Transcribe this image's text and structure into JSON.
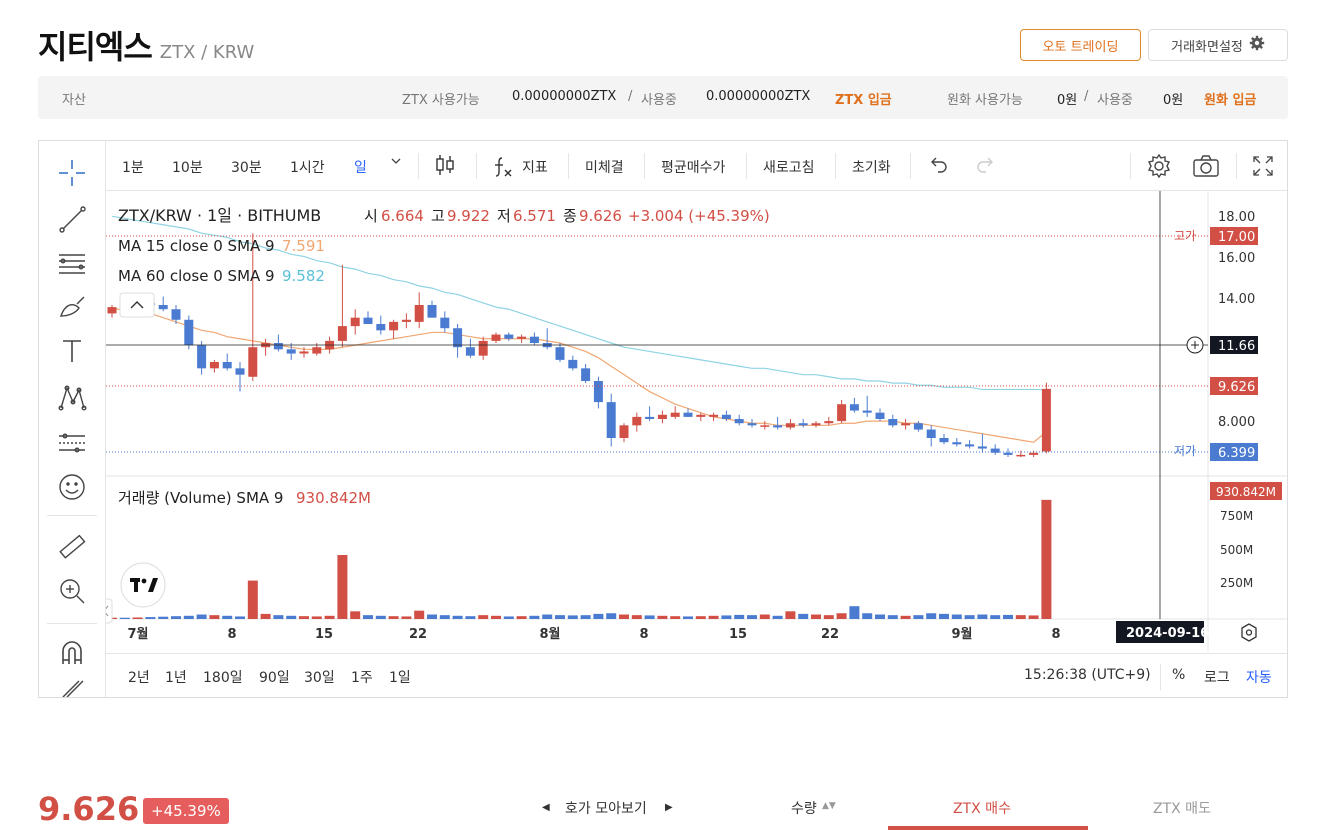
{
  "header": {
    "coin_name": "지티엑스",
    "pair": "ZTX / KRW",
    "auto_trading": "오토 트레이딩",
    "screen_settings": "거래화면설정"
  },
  "asset": {
    "label": "자산",
    "ztx_available_label": "ZTX 사용가능",
    "ztx_available": "0.00000000ZTX",
    "slash1": "/",
    "ztx_inuse_label": "사용중",
    "ztx_inuse": "0.00000000ZTX",
    "ztx_deposit": "ZTX 입금",
    "krw_available_label": "원화 사용가능",
    "krw_available": "0원",
    "slash2": "/",
    "krw_inuse_label": "사용중",
    "krw_inuse": "0원",
    "krw_deposit": "원화 입금"
  },
  "toolbar": {
    "i1m": "1분",
    "i10m": "10분",
    "i30m": "30분",
    "i1h": "1시간",
    "iday": "일",
    "indicator": "지표",
    "unfilled": "미체결",
    "avg_price": "평균매수가",
    "refresh": "새로고침",
    "reset": "초기화"
  },
  "legend": {
    "title": "ZTX/KRW · 1일 · BITHUMB",
    "o_label": "시",
    "o": "6.664",
    "h_label": "고",
    "h": "9.922",
    "l_label": "저",
    "l": "6.571",
    "c_label": "종",
    "c": "9.626",
    "change": "+3.004 (+45.39%)",
    "ma15_label": "MA 15 close 0 SMA 9",
    "ma15": "7.591",
    "ma60_label": "MA 60 close 0 SMA 9",
    "ma60": "9.582",
    "vol_label": "거래량 (Volume) SMA 9",
    "vol": "930.842M"
  },
  "price_axis": {
    "ticks": [
      "18.00",
      "16.00",
      "14.00",
      "8.000"
    ],
    "high_tag": "고가",
    "high_value": "17.00",
    "cross_value": "11.66",
    "last_value": "9.626",
    "low_tag": "저가",
    "low_value": "6.399",
    "vol_ticks": [
      "750M",
      "500M",
      "250M"
    ],
    "vol_last": "930.842M"
  },
  "time_axis": {
    "labels": [
      "7월",
      "8",
      "15",
      "22",
      "8월",
      "8",
      "15",
      "22",
      "9월",
      "8"
    ],
    "cursor_date": "2024-09-16"
  },
  "ranges": [
    "2년",
    "1년",
    "180일",
    "90일",
    "30일",
    "1주",
    "1일"
  ],
  "bottom_right": {
    "clock": "15:26:38 (UTC+9)",
    "percent": "%",
    "log": "로그",
    "auto": "자동"
  },
  "footer": {
    "price": "9.626",
    "change": "+45.39%",
    "orderbook": "호가 모아보기",
    "quantity": "수량",
    "buy": "ZTX 매수",
    "sell": "ZTX 매도"
  },
  "colors": {
    "up": "#d24f45",
    "down": "#4a7bd1",
    "ma15": "#f0a772",
    "ma60": "#8fd3e3",
    "accent": "#e0701c"
  },
  "chart_data": {
    "type": "candlestick",
    "series": [
      {
        "name": "candles",
        "values": [
          [
            13.2,
            13.6,
            13.0,
            13.5
          ],
          [
            13.5,
            13.7,
            13.2,
            13.4
          ],
          [
            13.6,
            13.8,
            13.4,
            13.7
          ],
          [
            13.7,
            13.9,
            13.5,
            13.6
          ],
          [
            13.6,
            14.0,
            13.3,
            13.4
          ],
          [
            13.4,
            13.6,
            12.7,
            12.9
          ],
          [
            12.9,
            13.1,
            11.5,
            11.7
          ],
          [
            11.7,
            11.9,
            10.3,
            10.6
          ],
          [
            10.6,
            11.0,
            10.4,
            10.9
          ],
          [
            10.9,
            11.3,
            10.5,
            10.6
          ],
          [
            10.6,
            10.9,
            9.5,
            10.3
          ],
          [
            10.2,
            17.0,
            10.0,
            11.6
          ],
          [
            11.6,
            12.0,
            11.2,
            11.8
          ],
          [
            11.8,
            12.2,
            11.4,
            11.5
          ],
          [
            11.5,
            11.8,
            11.0,
            11.3
          ],
          [
            11.3,
            11.6,
            11.1,
            11.4
          ],
          [
            11.3,
            11.8,
            11.2,
            11.6
          ],
          [
            11.5,
            12.1,
            11.3,
            11.9
          ],
          [
            11.9,
            15.5,
            11.6,
            12.6
          ],
          [
            12.6,
            13.4,
            12.2,
            13.0
          ],
          [
            13.0,
            13.3,
            12.7,
            12.7
          ],
          [
            12.7,
            13.1,
            12.2,
            12.4
          ],
          [
            12.4,
            12.9,
            12.0,
            12.8
          ],
          [
            12.8,
            13.2,
            12.5,
            12.9
          ],
          [
            12.8,
            14.2,
            12.5,
            13.6
          ],
          [
            13.6,
            13.8,
            13.0,
            13.0
          ],
          [
            13.0,
            13.3,
            12.3,
            12.5
          ],
          [
            12.5,
            12.7,
            11.1,
            11.6
          ],
          [
            11.6,
            12.0,
            11.1,
            11.2
          ],
          [
            11.2,
            12.1,
            11.0,
            11.9
          ],
          [
            11.9,
            12.3,
            11.8,
            12.2
          ],
          [
            12.2,
            12.3,
            11.9,
            12.0
          ],
          [
            12.0,
            12.2,
            11.8,
            12.1
          ],
          [
            12.1,
            12.3,
            11.7,
            11.8
          ],
          [
            11.8,
            12.5,
            11.5,
            11.6
          ],
          [
            11.6,
            11.8,
            10.9,
            11.0
          ],
          [
            11.0,
            11.2,
            10.5,
            10.6
          ],
          [
            10.6,
            10.8,
            9.9,
            10.0
          ],
          [
            10.0,
            10.2,
            8.7,
            9.0
          ],
          [
            9.0,
            9.4,
            6.9,
            7.3
          ],
          [
            7.3,
            8.0,
            7.1,
            7.9
          ],
          [
            7.9,
            8.5,
            7.6,
            8.3
          ],
          [
            8.3,
            8.8,
            8.1,
            8.2
          ],
          [
            8.2,
            8.6,
            8.0,
            8.4
          ],
          [
            8.3,
            8.8,
            8.2,
            8.5
          ],
          [
            8.5,
            8.7,
            8.3,
            8.3
          ],
          [
            8.3,
            8.5,
            8.1,
            8.4
          ],
          [
            8.3,
            8.5,
            8.1,
            8.4
          ],
          [
            8.4,
            8.6,
            8.1,
            8.2
          ],
          [
            8.2,
            8.4,
            7.9,
            8.0
          ],
          [
            8.0,
            8.2,
            7.8,
            7.9
          ],
          [
            7.9,
            8.1,
            7.7,
            7.9
          ],
          [
            7.9,
            8.3,
            7.7,
            7.8
          ],
          [
            7.8,
            8.2,
            7.7,
            8.0
          ],
          [
            8.0,
            8.2,
            7.8,
            7.9
          ],
          [
            7.9,
            8.1,
            7.8,
            8.0
          ],
          [
            8.0,
            8.3,
            7.9,
            8.1
          ],
          [
            8.1,
            9.1,
            8.0,
            8.9
          ],
          [
            8.9,
            9.2,
            8.5,
            8.6
          ],
          [
            8.6,
            9.3,
            8.3,
            8.5
          ],
          [
            8.5,
            8.7,
            8.1,
            8.2
          ],
          [
            8.2,
            8.4,
            7.8,
            7.9
          ],
          [
            7.9,
            8.2,
            7.7,
            8.0
          ],
          [
            8.0,
            8.1,
            7.6,
            7.7
          ],
          [
            7.7,
            7.9,
            6.9,
            7.3
          ],
          [
            7.3,
            7.5,
            7.0,
            7.1
          ],
          [
            7.1,
            7.3,
            6.9,
            7.0
          ],
          [
            7.0,
            7.2,
            6.8,
            6.9
          ],
          [
            6.9,
            7.5,
            6.6,
            6.8
          ],
          [
            6.8,
            7.0,
            6.5,
            6.6
          ],
          [
            6.6,
            6.8,
            6.4,
            6.5
          ],
          [
            6.5,
            6.7,
            6.4,
            6.5
          ],
          [
            6.5,
            6.7,
            6.4,
            6.6
          ],
          [
            6.664,
            9.922,
            6.571,
            9.626
          ]
        ]
      },
      {
        "name": "MA 15",
        "values": [
          13.4,
          13.4,
          13.3,
          13.2,
          13.0,
          12.8,
          12.6,
          12.4,
          12.3,
          12.1,
          12.0,
          11.9,
          11.8,
          11.7,
          11.6,
          11.5,
          11.5,
          11.5,
          11.6,
          11.7,
          11.8,
          11.9,
          12.0,
          12.1,
          12.2,
          12.3,
          12.3,
          12.2,
          12.1,
          12.0,
          12.0,
          12.0,
          12.0,
          12.0,
          11.9,
          11.8,
          11.6,
          11.4,
          11.1,
          10.7,
          10.3,
          9.9,
          9.5,
          9.2,
          8.9,
          8.7,
          8.5,
          8.3,
          8.2,
          8.1,
          8.0,
          8.0,
          7.9,
          7.9,
          7.9,
          7.9,
          7.9,
          8.0,
          8.0,
          8.1,
          8.1,
          8.1,
          8.0,
          8.0,
          7.9,
          7.8,
          7.7,
          7.6,
          7.5,
          7.4,
          7.3,
          7.2,
          7.1,
          7.591
        ]
      },
      {
        "name": "MA 60",
        "values": [
          17.8,
          17.7,
          17.6,
          17.5,
          17.4,
          17.3,
          17.2,
          17.0,
          16.9,
          16.8,
          16.6,
          16.5,
          16.3,
          16.2,
          16.0,
          15.9,
          15.7,
          15.6,
          15.4,
          15.3,
          15.1,
          15.0,
          14.8,
          14.7,
          14.5,
          14.4,
          14.2,
          14.1,
          13.9,
          13.7,
          13.5,
          13.4,
          13.2,
          13.0,
          12.8,
          12.6,
          12.4,
          12.2,
          12.0,
          11.8,
          11.6,
          11.5,
          11.4,
          11.3,
          11.2,
          11.1,
          11.0,
          10.9,
          10.8,
          10.7,
          10.6,
          10.6,
          10.5,
          10.4,
          10.3,
          10.3,
          10.2,
          10.1,
          10.1,
          10.0,
          10.0,
          9.9,
          9.9,
          9.8,
          9.8,
          9.7,
          9.7,
          9.7,
          9.6,
          9.6,
          9.6,
          9.6,
          9.6,
          9.582
        ]
      },
      {
        "name": "volume",
        "values": [
          10,
          10,
          12,
          15,
          18,
          22,
          25,
          35,
          30,
          25,
          20,
          300,
          40,
          30,
          25,
          22,
          20,
          25,
          500,
          60,
          30,
          25,
          22,
          20,
          65,
          35,
          30,
          25,
          22,
          30,
          25,
          20,
          22,
          25,
          35,
          30,
          28,
          30,
          40,
          45,
          35,
          30,
          28,
          25,
          22,
          20,
          22,
          25,
          28,
          32,
          30,
          35,
          25,
          60,
          40,
          35,
          30,
          45,
          100,
          45,
          35,
          30,
          25,
          30,
          45,
          40,
          35,
          30,
          35,
          30,
          32,
          30,
          28,
          930.842
        ]
      }
    ],
    "ylim": [
      5.5,
      19.0
    ],
    "volume_ylim": [
      0,
      1000
    ]
  }
}
